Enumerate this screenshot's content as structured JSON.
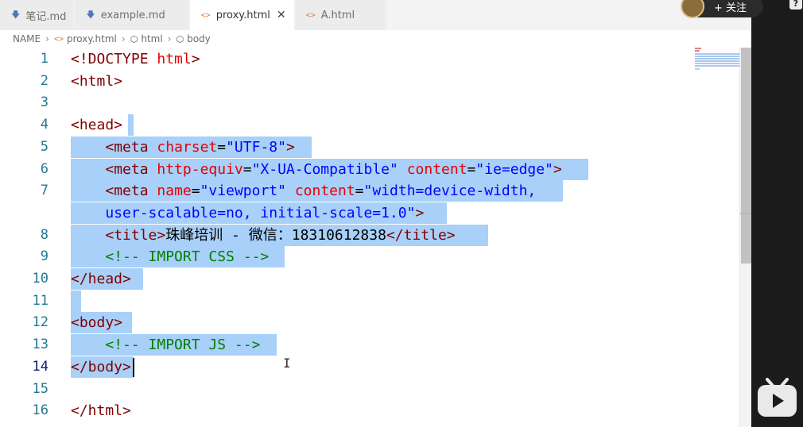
{
  "tabs": [
    {
      "icon": "markdown-icon",
      "label": "笔记.md",
      "active": false
    },
    {
      "icon": "markdown-icon",
      "label": "example.md",
      "active": false
    },
    {
      "icon": "html-icon",
      "label": "proxy.html",
      "active": true
    },
    {
      "icon": "html-icon",
      "label": "A.html",
      "active": false
    }
  ],
  "breadcrumb": {
    "root": "NAME",
    "file": "proxy.html",
    "node1": "html",
    "node2": "body"
  },
  "overlay": {
    "follow_label": "+ 关注"
  },
  "editor": {
    "current_line": 14,
    "lines": [
      {
        "num": "1",
        "parts": [
          [
            "tag",
            "<!DOCTYPE "
          ],
          [
            "attr",
            "html"
          ],
          [
            "tag",
            ">"
          ]
        ]
      },
      {
        "num": "2",
        "parts": [
          [
            "tag",
            "<html>"
          ]
        ]
      },
      {
        "num": "3",
        "parts": []
      },
      {
        "num": "4",
        "parts": [
          [
            "tag",
            "<head>"
          ]
        ]
      },
      {
        "num": "5",
        "parts": [
          [
            "txt",
            "    "
          ],
          [
            "tag",
            "<meta "
          ],
          [
            "attr",
            "charset"
          ],
          [
            "txt",
            "="
          ],
          [
            "str",
            "\"UTF-8\""
          ],
          [
            "tag",
            ">"
          ]
        ]
      },
      {
        "num": "6",
        "parts": [
          [
            "txt",
            "    "
          ],
          [
            "tag",
            "<meta "
          ],
          [
            "attr",
            "http-equiv"
          ],
          [
            "txt",
            "="
          ],
          [
            "str",
            "\"X-UA-Compatible\""
          ],
          [
            "txt",
            " "
          ],
          [
            "attr",
            "content"
          ],
          [
            "txt",
            "="
          ],
          [
            "str",
            "\"ie=edge\""
          ],
          [
            "tag",
            ">"
          ]
        ]
      },
      {
        "num": "7",
        "parts": [
          [
            "txt",
            "    "
          ],
          [
            "tag",
            "<meta "
          ],
          [
            "attr",
            "name"
          ],
          [
            "txt",
            "="
          ],
          [
            "str",
            "\"viewport\""
          ],
          [
            "txt",
            " "
          ],
          [
            "attr",
            "content"
          ],
          [
            "txt",
            "="
          ],
          [
            "str",
            "\"width=device-width,"
          ]
        ]
      },
      {
        "num": "",
        "parts": [
          [
            "str",
            "    user-scalable=no, initial-scale=1.0\""
          ],
          [
            "tag",
            ">"
          ]
        ]
      },
      {
        "num": "8",
        "parts": [
          [
            "txt",
            "    "
          ],
          [
            "tag",
            "<title>"
          ],
          [
            "txt",
            "珠峰培训 - 微信：18310612838"
          ],
          [
            "tag",
            "</title>"
          ]
        ]
      },
      {
        "num": "9",
        "parts": [
          [
            "txt",
            "    "
          ],
          [
            "cmt",
            "<!-- IMPORT CSS -->"
          ]
        ]
      },
      {
        "num": "10",
        "parts": [
          [
            "tag",
            "</head>"
          ]
        ]
      },
      {
        "num": "11",
        "parts": []
      },
      {
        "num": "12",
        "parts": [
          [
            "tag",
            "<body>"
          ]
        ]
      },
      {
        "num": "13",
        "parts": [
          [
            "txt",
            "    "
          ],
          [
            "cmt",
            "<!-- IMPORT JS -->"
          ]
        ]
      },
      {
        "num": "14",
        "parts": [
          [
            "tag",
            "</body>"
          ]
        ]
      },
      {
        "num": "15",
        "parts": []
      },
      {
        "num": "16",
        "parts": [
          [
            "tag",
            "</html>"
          ]
        ]
      }
    ]
  }
}
